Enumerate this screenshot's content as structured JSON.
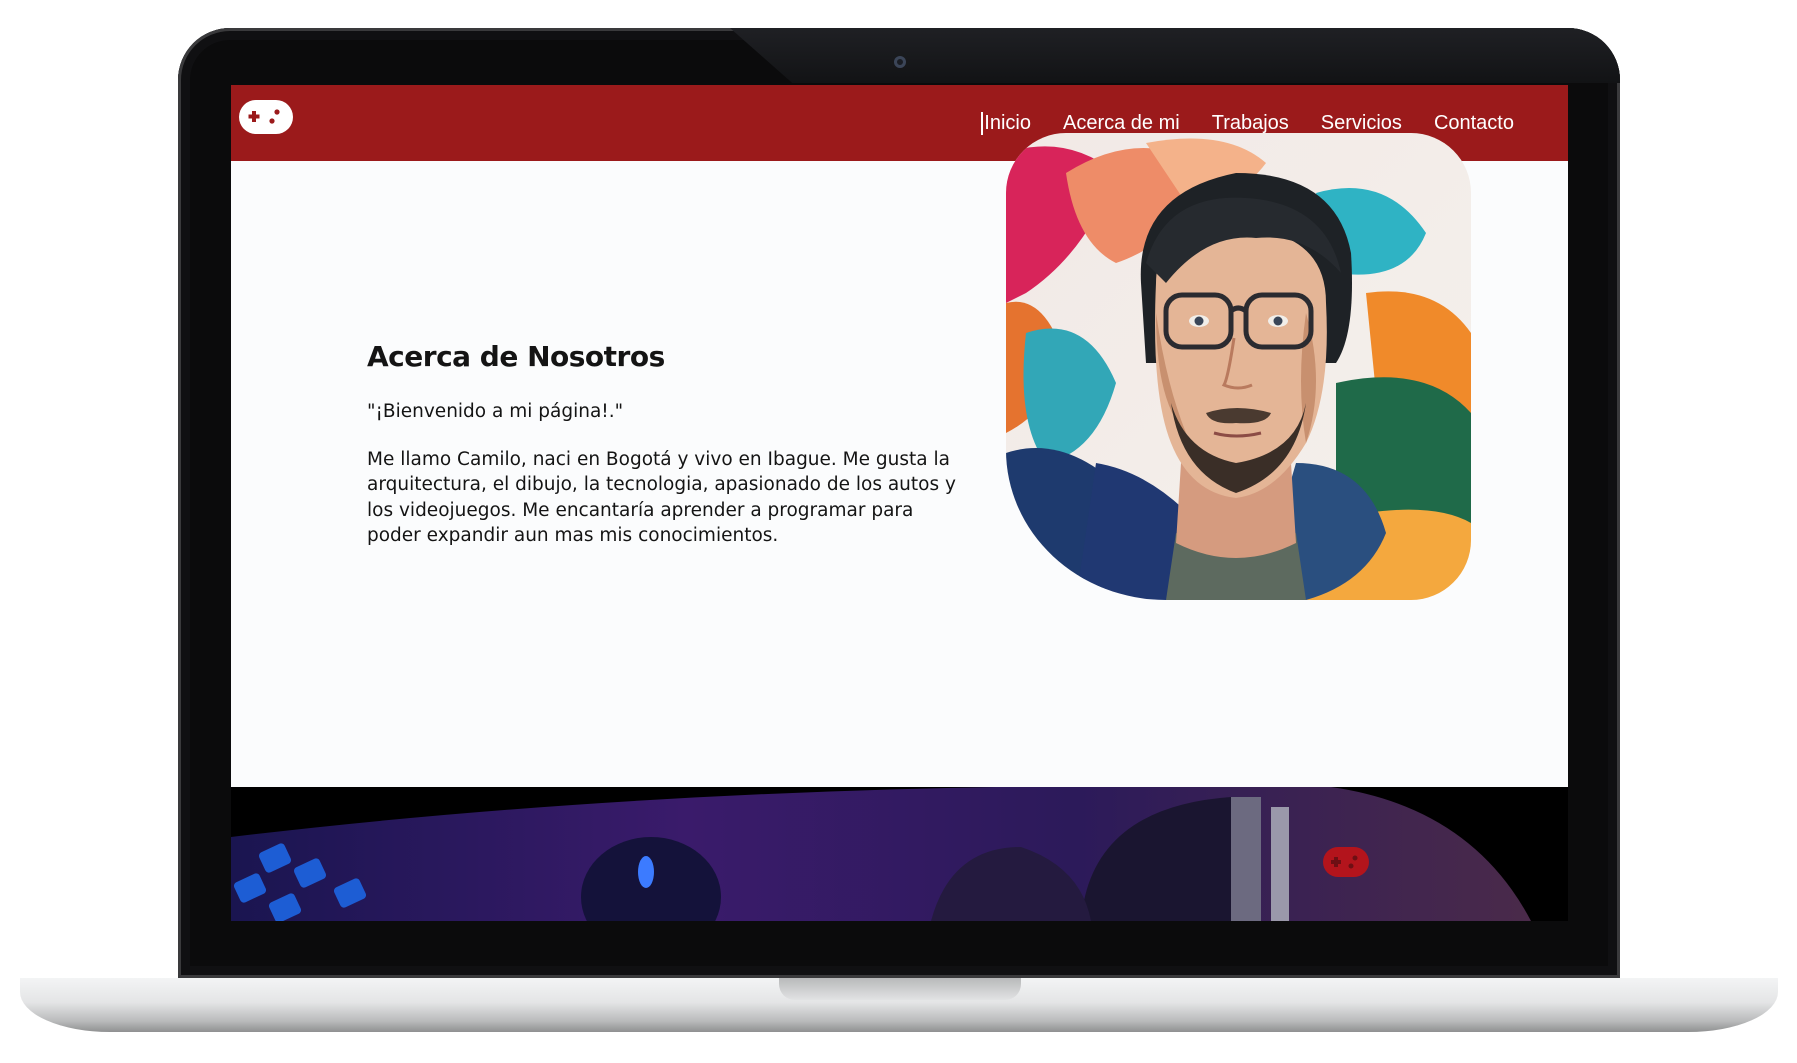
{
  "nav": {
    "logo_icon": "gamepad-icon",
    "links": [
      "Inicio",
      "Acerca de mi",
      "Trabajos",
      "Servicios",
      "Contacto"
    ],
    "active_index": 0
  },
  "about": {
    "title": "Acerca de Nosotros",
    "welcome": "\"¡Bienvenido a mi página!.\"",
    "body": "Me llamo Camilo, naci en Bogotá y vivo en Ibague. Me gusta la arquitectura, el dibujo, la tecnologia, apasionado de los autos y los videojuegos. Me encantaría aprender a programar para poder expandir aun mas mis conocimientos."
  },
  "colors": {
    "navbar": "#9b1a1b",
    "nav_text": "#ffffff",
    "page_bg": "#fbfcfd",
    "text": "#141414",
    "floating_button": "#b3141c"
  },
  "floating_button_icon": "gamepad-icon"
}
